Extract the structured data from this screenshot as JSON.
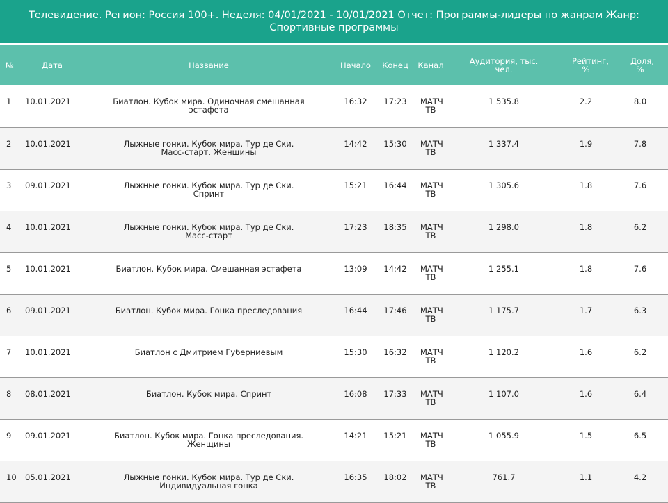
{
  "report": {
    "title": "Телевидение. Регион: Россия 100+. Неделя: 04/01/2021 - 10/01/2021 Отчет: Программы-лидеры по жанрам Жанр: Спортивные программы"
  },
  "table": {
    "headers": {
      "no": "№",
      "date": "Дата",
      "name": "Название",
      "start": "Начало",
      "end": "Конец",
      "channel": "Канал",
      "audience": "Аудитория, тыс. чел.",
      "rating": "Рейтинг, %",
      "share": "Доля, %"
    },
    "rows": [
      {
        "no": "1",
        "date": "10.01.2021",
        "name": "Биатлон. Кубок мира. Одиночная смешанная эстафета",
        "start": "16:32",
        "end": "17:23",
        "channel": "МАТЧ ТВ",
        "audience": "1 535.8",
        "rating": "2.2",
        "share": "8.0"
      },
      {
        "no": "2",
        "date": "10.01.2021",
        "name": "Лыжные гонки. Кубок мира. Тур де Ски. Масс-старт. Женщины",
        "start": "14:42",
        "end": "15:30",
        "channel": "МАТЧ ТВ",
        "audience": "1 337.4",
        "rating": "1.9",
        "share": "7.8"
      },
      {
        "no": "3",
        "date": "09.01.2021",
        "name": "Лыжные гонки. Кубок мира. Тур де Ски. Спринт",
        "start": "15:21",
        "end": "16:44",
        "channel": "МАТЧ ТВ",
        "audience": "1 305.6",
        "rating": "1.8",
        "share": "7.6"
      },
      {
        "no": "4",
        "date": "10.01.2021",
        "name": "Лыжные гонки. Кубок мира. Тур де Ски. Масс-старт",
        "start": "17:23",
        "end": "18:35",
        "channel": "МАТЧ ТВ",
        "audience": "1 298.0",
        "rating": "1.8",
        "share": "6.2"
      },
      {
        "no": "5",
        "date": "10.01.2021",
        "name": "Биатлон. Кубок мира. Смешанная эстафета",
        "start": "13:09",
        "end": "14:42",
        "channel": "МАТЧ ТВ",
        "audience": "1 255.1",
        "rating": "1.8",
        "share": "7.6"
      },
      {
        "no": "6",
        "date": "09.01.2021",
        "name": "Биатлон. Кубок мира. Гонка преследования",
        "start": "16:44",
        "end": "17:46",
        "channel": "МАТЧ ТВ",
        "audience": "1 175.7",
        "rating": "1.7",
        "share": "6.3"
      },
      {
        "no": "7",
        "date": "10.01.2021",
        "name": "Биатлон с Дмитрием Губерниевым",
        "start": "15:30",
        "end": "16:32",
        "channel": "МАТЧ ТВ",
        "audience": "1 120.2",
        "rating": "1.6",
        "share": "6.2"
      },
      {
        "no": "8",
        "date": "08.01.2021",
        "name": "Биатлон. Кубок мира. Спринт",
        "start": "16:08",
        "end": "17:33",
        "channel": "МАТЧ ТВ",
        "audience": "1 107.0",
        "rating": "1.6",
        "share": "6.4"
      },
      {
        "no": "9",
        "date": "09.01.2021",
        "name": "Биатлон. Кубок мира. Гонка преследования. Женщины",
        "start": "14:21",
        "end": "15:21",
        "channel": "МАТЧ ТВ",
        "audience": "1 055.9",
        "rating": "1.5",
        "share": "6.5"
      },
      {
        "no": "10",
        "date": "05.01.2021",
        "name": "Лыжные гонки. Кубок мира. Тур де Ски. Индивидуальная гонка",
        "start": "16:35",
        "end": "18:02",
        "channel": "МАТЧ ТВ",
        "audience": "761.7",
        "rating": "1.1",
        "share": "4.2"
      }
    ]
  },
  "colors": {
    "title_bar": "#1aa38c",
    "header_row": "#5cc0ac",
    "row_alt": "#f4f4f4",
    "row_border": "#9a9a9a"
  }
}
